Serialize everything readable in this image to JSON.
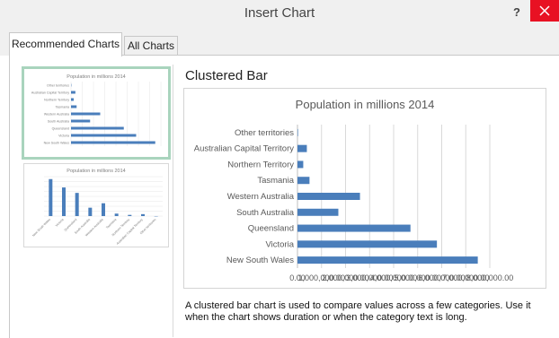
{
  "dialog": {
    "title": "Insert Chart",
    "help_label": "?"
  },
  "tabs": [
    {
      "label": "Recommended Charts",
      "active": true
    },
    {
      "label": "All Charts",
      "active": false
    }
  ],
  "thumbnails": [
    {
      "chart_type": "clustered-bar",
      "selected": true,
      "title": "Population in millions 2014"
    },
    {
      "chart_type": "clustered-column",
      "selected": false,
      "title": "Population in millions 2014"
    }
  ],
  "preview": {
    "heading": "Clustered Bar",
    "description": "A clustered bar chart is used to compare values across a few categories. Use it when the chart shows duration or when the category text is long."
  },
  "colors": {
    "bar": "#4a7ebb",
    "selected_border": "#a9d4bd",
    "close_button": "#e81123"
  },
  "chart_data": {
    "type": "bar",
    "orientation": "horizontal",
    "title": "Population in millions 2014",
    "categories": [
      "New South Wales",
      "Victoria",
      "Queensland",
      "South Australia",
      "Western Australia",
      "Tasmania",
      "Northern Territory",
      "Australian Capital Territory",
      "Other territories"
    ],
    "values": [
      7500000,
      5800000,
      4700000,
      1700000,
      2600000,
      500000,
      240000,
      390000,
      3000
    ],
    "x_ticks": [
      "0.00",
      "1,000,000.00",
      "2,000,000.00",
      "3,000,000.00",
      "4,000,000.00",
      "5,000,000.00",
      "6,000,000.00",
      "7,000,000.00",
      "8,000,000.00"
    ],
    "xlim": [
      0,
      8000000
    ],
    "grid": true,
    "legend": "none"
  }
}
